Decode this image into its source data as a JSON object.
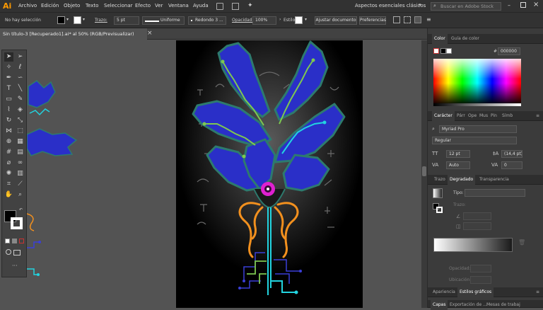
{
  "app": {
    "logo": "Ai"
  },
  "menu": [
    "Archivo",
    "Edición",
    "Objeto",
    "Texto",
    "Seleccionar",
    "Efecto",
    "Ver",
    "Ventana",
    "Ayuda"
  ],
  "workspace": {
    "label": "Aspectos esenciales clásicos",
    "search_placeholder": "Buscar en Adobe Stock"
  },
  "control": {
    "selection": "No hay selección",
    "stroke_label": "Trazo:",
    "stroke_value": "5 pt",
    "profile": "Uniforme",
    "brush": "Redondo 3 ...",
    "opacity_label": "Opacidad:",
    "opacity_value": "100%",
    "style_label": "Estilo:",
    "align_doc": "Ajustar documento",
    "prefs": "Preferencias"
  },
  "document": {
    "tab": "Sin título-3 [Recuperado1].ai* al 50% (RGB/Previsualizar)",
    "close": "×"
  },
  "color_panel": {
    "tabs": [
      "Color",
      "Guía de color"
    ],
    "hex_label": "#",
    "hex": "000000"
  },
  "character_panel": {
    "tabs": [
      "Carácter",
      "Párr",
      "Ope",
      "Mus",
      "Pin",
      "Símb"
    ],
    "font": "Myriad Pro",
    "style": "Regular",
    "size": "12 pt",
    "leading": "(14,4 pt)",
    "kerning": "Auto",
    "tracking": "0"
  },
  "gradient_panel": {
    "tabs": [
      "Trazo",
      "Degradado",
      "Transparencia"
    ],
    "type_label": "Tipo:",
    "stroke_label": "Trazo:",
    "opacity_label": "Opacidad:",
    "location_label": "Ubicación:"
  },
  "bottom_tabs": {
    "row1": [
      "Apariencia",
      "Estilos gráficos"
    ],
    "row2": [
      "Capas",
      "Exportación de ...",
      "Mesas de trabaj"
    ]
  },
  "colors": {
    "accent_blue": "#3a3fd8",
    "accent_cyan": "#22d4e0",
    "accent_orange": "#f2901e",
    "accent_green": "#7ec850",
    "accent_magenta": "#e020d0"
  }
}
